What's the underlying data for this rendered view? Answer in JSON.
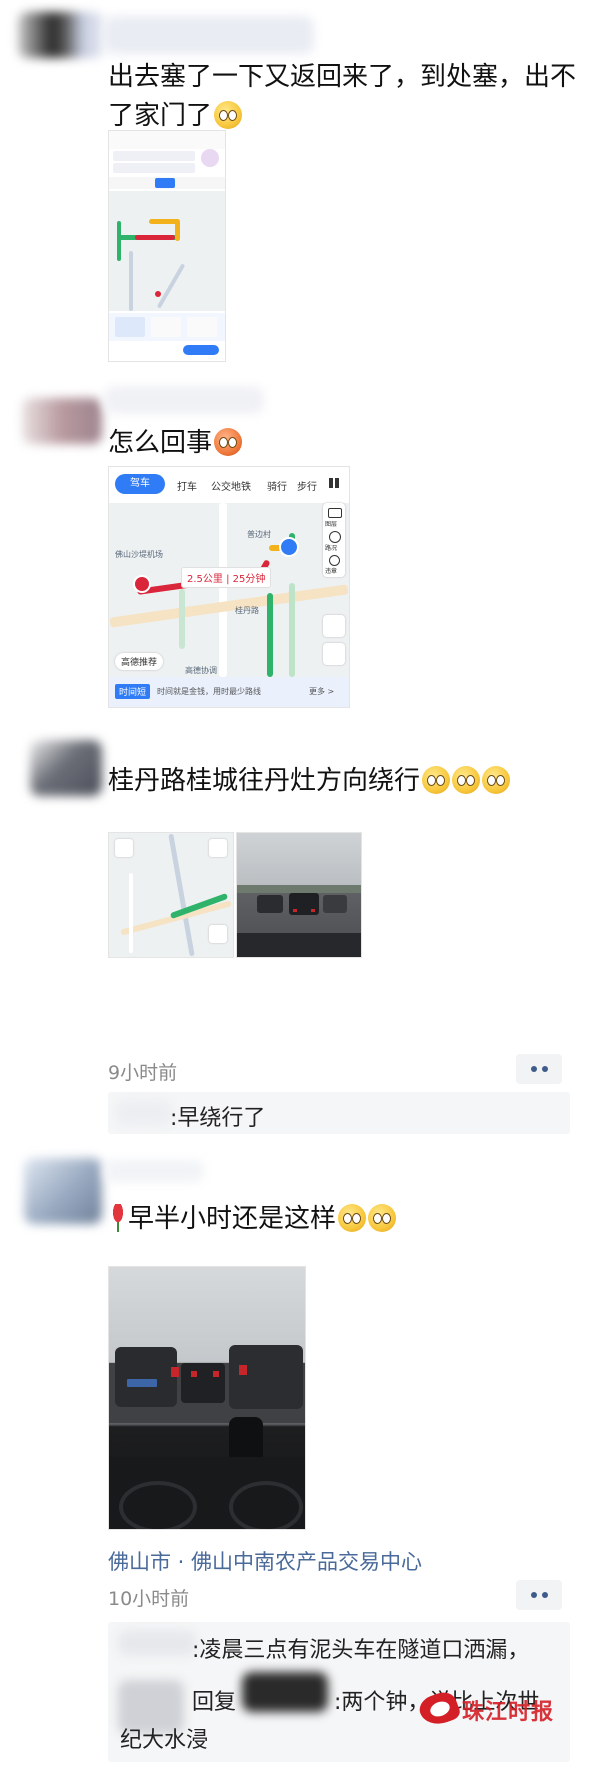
{
  "posts": [
    {
      "text": "出去塞了一下又返回来了，到处塞，出不了家门了",
      "emoji": "face-grimace"
    },
    {
      "text": "怎么回事",
      "emoji": "face-angry",
      "map": {
        "tabs": [
          "驾车",
          "打车",
          "公交地铁",
          "骑行",
          "步行"
        ],
        "route_label": "2.5公里 | 25分钟",
        "place_labels": [
          "普边村",
          "佛山沙堤机场",
          "桂丹路",
          "高德推荐",
          "高德协调"
        ],
        "side_icons": [
          "图层",
          "路况",
          "违章"
        ],
        "footer_tag": "时间短",
        "footer_text": "时间就是金钱，用时最少路线",
        "footer_more": "更多 >"
      }
    },
    {
      "text": "桂丹路桂城往丹灶方向绕行",
      "emoji_count": 3,
      "time": "9小时前",
      "comment_text": ":早绕行了"
    },
    {
      "text": "早半小时还是这样",
      "location": "佛山市 · 佛山中南农产品交易中心",
      "time": "10小时前",
      "comment_lines": [
        ":凌晨三点有泥头车在隧道口洒漏，",
        "回复",
        ":两个钟，说比上次世",
        "纪大水浸"
      ]
    }
  ],
  "watermark": "珠江时报",
  "colors": {
    "link": "#4a6a9a",
    "meta": "#8a8a8a",
    "route_red": "#d9263b",
    "route_green": "#2fb36b",
    "route_yellow": "#f3b21b",
    "nav_blue": "#2f7cf6"
  }
}
